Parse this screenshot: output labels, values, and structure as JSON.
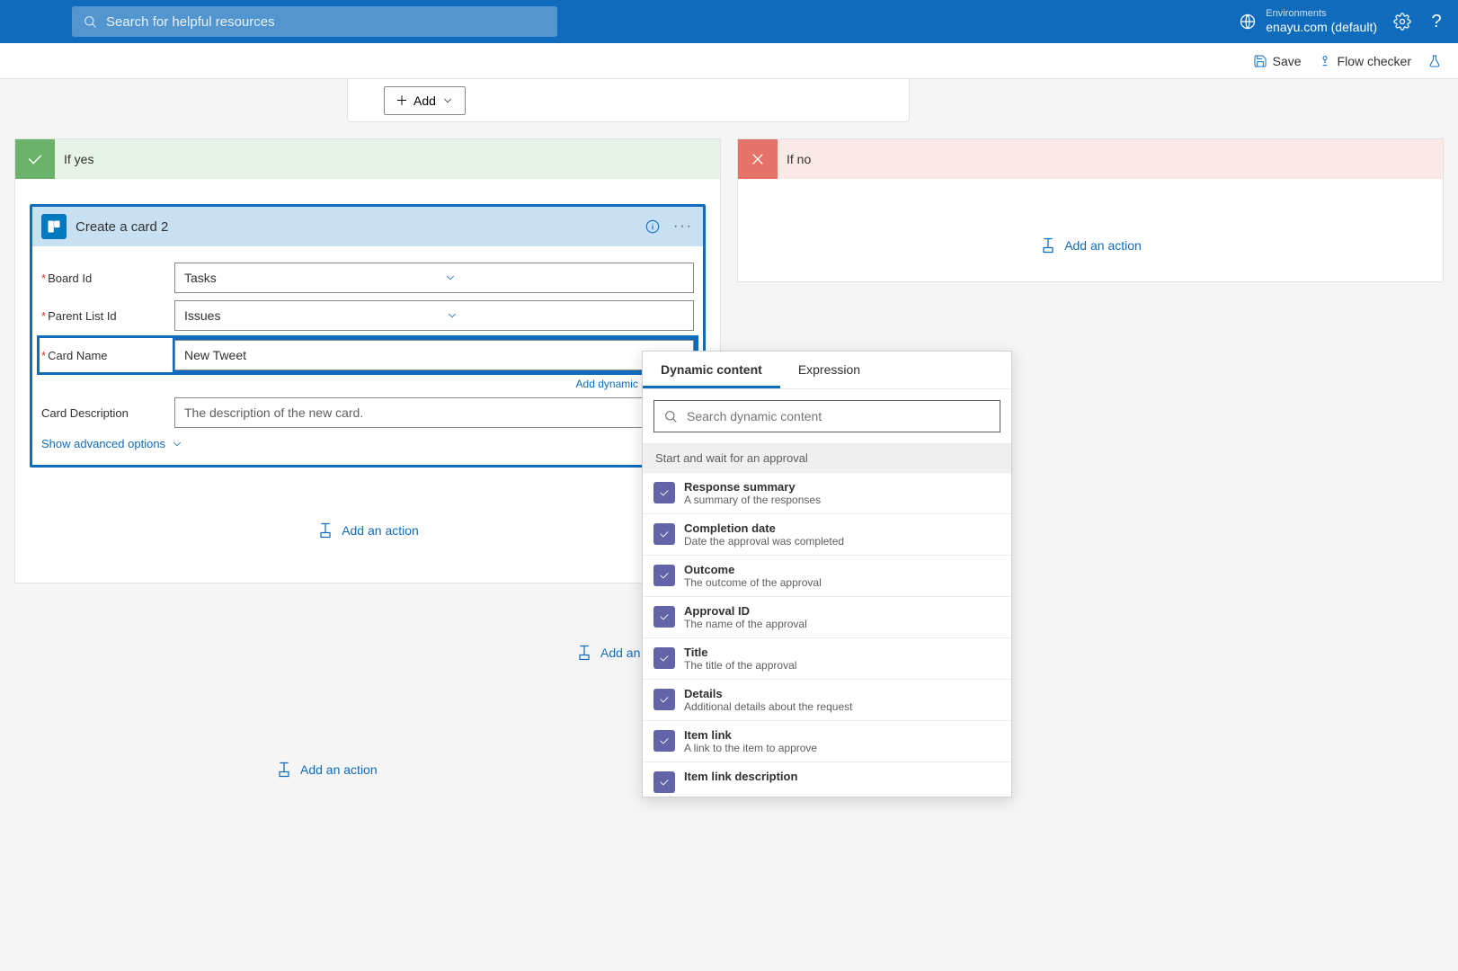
{
  "topbar": {
    "search_placeholder": "Search for helpful resources",
    "environments_label": "Environments",
    "environment_name": "enayu.com (default)"
  },
  "commandbar": {
    "save": "Save",
    "flow_checker": "Flow checker"
  },
  "peek": {
    "add": "Add"
  },
  "condition": {
    "if_yes": "If yes",
    "if_no": "If no"
  },
  "card": {
    "title": "Create a card 2",
    "params": {
      "board_id": {
        "label": "Board Id",
        "value": "Tasks"
      },
      "parent_list_id": {
        "label": "Parent List Id",
        "value": "Issues"
      },
      "card_name": {
        "label": "Card Name",
        "value": "New Tweet"
      },
      "card_description": {
        "label": "Card Description",
        "placeholder": "The description of the new card."
      }
    },
    "add_dynamic": "Add dynamic content",
    "advanced": "Show advanced options"
  },
  "add_action": "Add an action",
  "add_action_partial": "Add an a",
  "dc": {
    "tabs": {
      "dynamic": "Dynamic content",
      "expression": "Expression"
    },
    "search_placeholder": "Search dynamic content",
    "group": "Start and wait for an approval",
    "items": [
      {
        "title": "Response summary",
        "desc": "A summary of the responses"
      },
      {
        "title": "Completion date",
        "desc": "Date the approval was completed"
      },
      {
        "title": "Outcome",
        "desc": "The outcome of the approval"
      },
      {
        "title": "Approval ID",
        "desc": "The name of the approval"
      },
      {
        "title": "Title",
        "desc": "The title of the approval"
      },
      {
        "title": "Details",
        "desc": "Additional details about the request"
      },
      {
        "title": "Item link",
        "desc": "A link to the item to approve"
      },
      {
        "title": "Item link description",
        "desc": ""
      }
    ]
  }
}
